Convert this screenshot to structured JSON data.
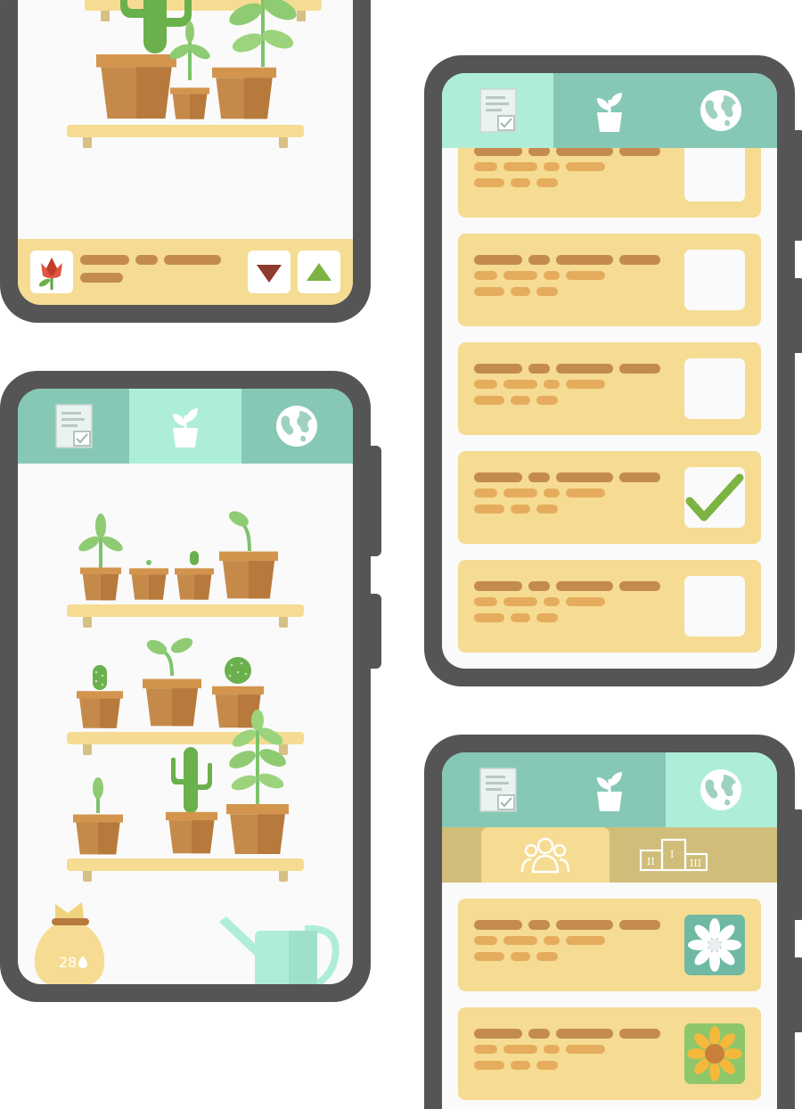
{
  "colors": {
    "phone_frame": "#555555",
    "tab_bar": "#86c8b5",
    "tab_active": "#aeeed9",
    "card": "#f5dc92",
    "card_bar_dark": "#c48b4e",
    "card_bar_light": "#e6ac5e",
    "check_green": "#7cb342",
    "pot": "#c58a4a",
    "leaf": "#7cc36b"
  },
  "tabs": [
    {
      "icon": "document-check-icon"
    },
    {
      "icon": "potted-plant-icon"
    },
    {
      "icon": "globe-icon"
    }
  ],
  "phone_tasks": {
    "active_tab": 0,
    "tasks": [
      {
        "checked": false
      },
      {
        "checked": false
      },
      {
        "checked": false
      },
      {
        "checked": true
      },
      {
        "checked": false
      }
    ]
  },
  "phone_garden": {
    "active_tab": 1,
    "seed_bag": {
      "count": "28",
      "icon": "water-drop-icon"
    },
    "watering_can": {
      "icon": "watering-can-icon"
    }
  },
  "phone_plant_detail": {
    "plant_icon": "red-flower-icon",
    "down_button_icon": "triangle-down-icon",
    "up_button_icon": "triangle-up-icon"
  },
  "phone_community": {
    "active_tab": 2,
    "sub_tabs": [
      {
        "icon": "friends-icon",
        "active": true
      },
      {
        "icon": "podium-icon",
        "active": false
      }
    ],
    "podium_labels": [
      "II",
      "I",
      "III"
    ],
    "entries": [
      {
        "badge_icon": "white-flower-icon"
      },
      {
        "badge_icon": "sunflower-icon"
      }
    ]
  }
}
